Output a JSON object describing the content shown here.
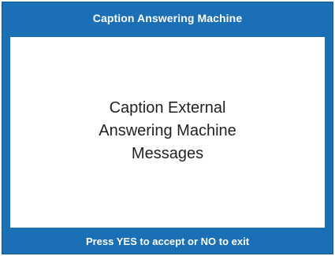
{
  "header": {
    "title": "Caption Answering Machine"
  },
  "main": {
    "message_lines": [
      "Caption External",
      "Answering Machine",
      "Messages"
    ]
  },
  "footer": {
    "instruction": "Press YES to accept or NO to exit"
  },
  "colors": {
    "frame_blue": "#1b6fb4",
    "panel_white": "#ffffff",
    "text_dark": "#231f20",
    "bar_text": "#ffffff"
  }
}
